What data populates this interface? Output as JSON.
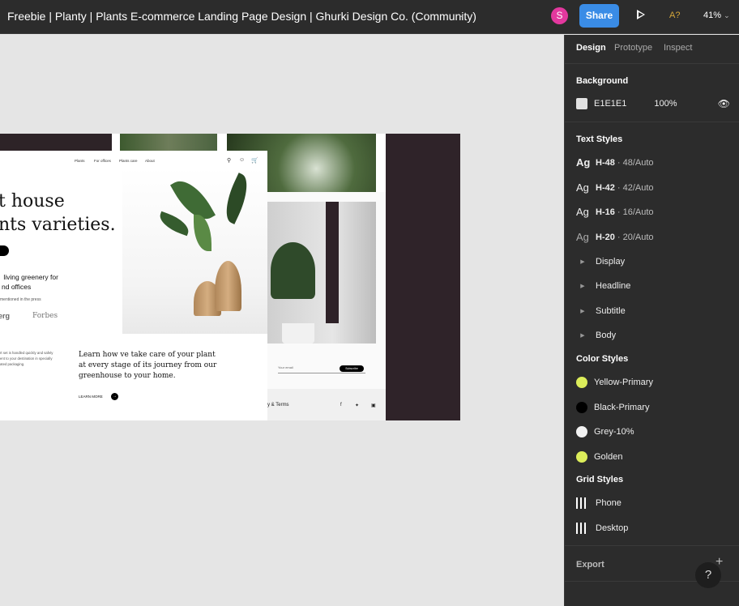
{
  "topbar": {
    "file_title": "Freebie | Planty | Plants E-commerce Landing Page Design | Ghurki Design Co. (Community)",
    "avatar_initial": "S",
    "share_label": "Share",
    "a11y_label": "A?",
    "zoom_level": "41%"
  },
  "panel": {
    "tabs": [
      "Design",
      "Prototype",
      "Inspect"
    ],
    "background": {
      "title": "Background",
      "color": "E1E1E1",
      "opacity": "100%",
      "swatch": "#e1e1e1"
    },
    "text_styles": {
      "title": "Text Styles",
      "items": [
        {
          "sample": "Ag",
          "name": "H-48",
          "meta": " · 48/Auto"
        },
        {
          "sample": "Ag",
          "name": "H-42",
          "meta": " · 42/Auto"
        },
        {
          "sample": "Ag",
          "name": "H-16",
          "meta": " · 16/Auto"
        },
        {
          "sample": "Ag",
          "name": "H-20",
          "meta": " · 20/Auto"
        }
      ],
      "groups": [
        "Display",
        "Headline",
        "Subtitle",
        "Body"
      ]
    },
    "color_styles": {
      "title": "Color Styles",
      "items": [
        {
          "name": "Yellow-Primary",
          "color": "#dced5a"
        },
        {
          "name": "Black-Primary",
          "color": "#000000"
        },
        {
          "name": "Grey-10%",
          "color": "#f2f2f2"
        },
        {
          "name": "Golden",
          "color": "#dced5a"
        }
      ]
    },
    "grid_styles": {
      "title": "Grid Styles",
      "items": [
        "Phone",
        "Desktop"
      ]
    },
    "export_label": "Export",
    "help_label": "?"
  },
  "artboard": {
    "nav": [
      "Plants",
      "For offices",
      "Plants care",
      "About"
    ],
    "hero_title": "t house\nnts varieties.",
    "subtitle": " living greenery for\nnd offices",
    "press_text": "mentioned in the press",
    "press_logos": [
      "erg",
      "Forbes"
    ],
    "small_text": "rt set is handled quickly and safely\nent to your destination in specially\nated packaging.",
    "learn_text": "Learn how ve take care of your plant\nat every stage of its journey from our\ngreenhouse to your home.",
    "learn_more": "LEARN MORE",
    "email_placeholder": "Your email",
    "subscribe_label": "Subscribe",
    "footer_text": "y & Terms"
  }
}
